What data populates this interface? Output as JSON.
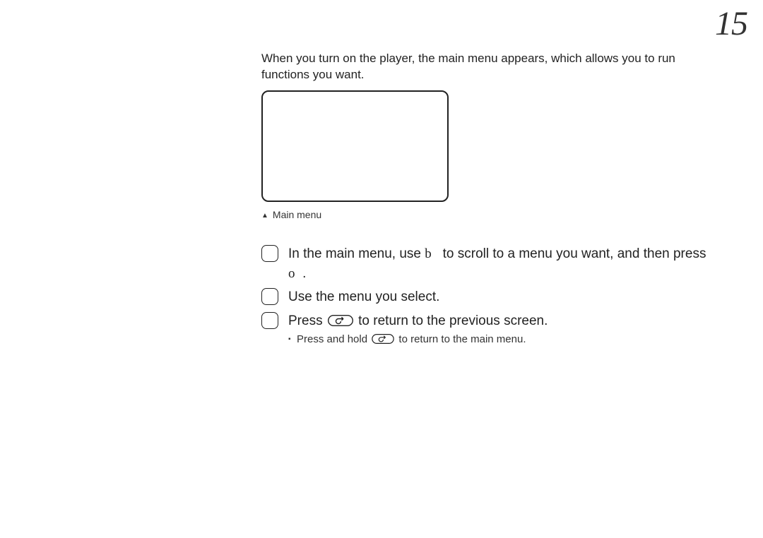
{
  "page_number": "15",
  "intro": "When you turn on the player, the main menu appears, which allows you to run functions you want.",
  "caption_marker": "▲",
  "caption": "Main menu",
  "steps": {
    "s1a": "In the main menu, use ",
    "s1_glyph1": "b",
    "s1b": " to scroll to a menu you want, and then press ",
    "s1_glyph2": "o",
    "s1c": ".",
    "s2": "Use the menu you select.",
    "s3a": "Press ",
    "s3b": " to return to the previous screen.",
    "sub_a": "Press and hold ",
    "sub_b": " to return to the main menu."
  }
}
